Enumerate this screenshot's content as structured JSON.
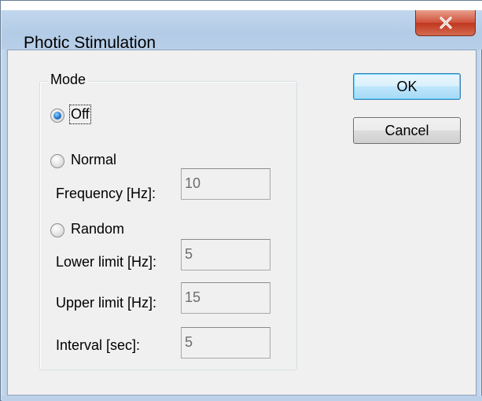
{
  "window": {
    "title": "Photic Stimulation",
    "close_glyph": "X"
  },
  "mode_group": {
    "label": "Mode",
    "options": [
      {
        "label": "Off",
        "checked": true
      },
      {
        "label": "Normal",
        "checked": false
      },
      {
        "label": "Random",
        "checked": false
      }
    ]
  },
  "normal": {
    "frequency_label": "Frequency [Hz]:",
    "frequency_value": "10"
  },
  "random": {
    "lower_label": "Lower limit [Hz]:",
    "lower_value": "5",
    "upper_label": "Upper limit [Hz]:",
    "upper_value": "15",
    "interval_label": "Interval [sec]:",
    "interval_value": "5"
  },
  "buttons": {
    "ok": "OK",
    "cancel": "Cancel"
  }
}
